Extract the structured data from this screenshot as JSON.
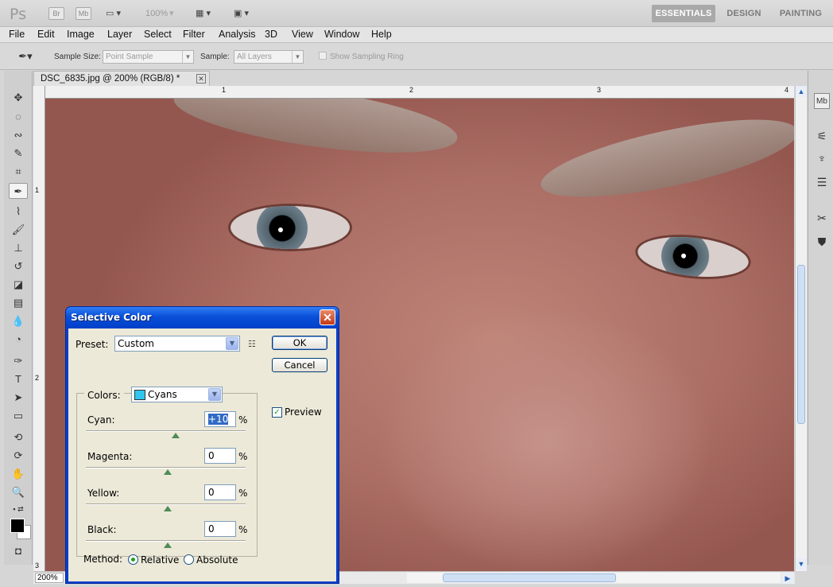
{
  "app": {
    "logo": "Ps",
    "bridge": "Br",
    "minibridge": "Mb",
    "zoom": "100%",
    "workspaces": [
      "ESSENTIALS",
      "DESIGN",
      "PAINTING"
    ]
  },
  "menu": [
    "File",
    "Edit",
    "Image",
    "Layer",
    "Select",
    "Filter",
    "Analysis",
    "3D",
    "View",
    "Window",
    "Help"
  ],
  "options": {
    "sample_size_label": "Sample Size:",
    "sample_size_value": "Point Sample",
    "sample_label": "Sample:",
    "sample_value": "All Layers",
    "show_ring_label": "Show Sampling Ring"
  },
  "document": {
    "tab_title": "DSC_6835.jpg @ 200% (RGB/8) *",
    "zoom": "200%",
    "ruler_h": [
      "1",
      "2",
      "3",
      "4"
    ],
    "ruler_v": [
      "1",
      "2",
      "3"
    ]
  },
  "dialog": {
    "title": "Selective Color",
    "preset_label": "Preset:",
    "preset_value": "Custom",
    "colors_label": "Colors:",
    "colors_value": "Cyans",
    "ok": "OK",
    "cancel": "Cancel",
    "preview": "Preview",
    "sliders": [
      {
        "label": "Cyan:",
        "value": "+10"
      },
      {
        "label": "Magenta:",
        "value": "0"
      },
      {
        "label": "Yellow:",
        "value": "0"
      },
      {
        "label": "Black:",
        "value": "0"
      }
    ],
    "percent": "%",
    "method_label": "Method:",
    "method_relative": "Relative",
    "method_absolute": "Absolute"
  },
  "colors": {
    "cyan_swatch": "#2fc6f0",
    "title_blue": "#0a4fd8",
    "essentials_active": "#a9a9a9"
  }
}
